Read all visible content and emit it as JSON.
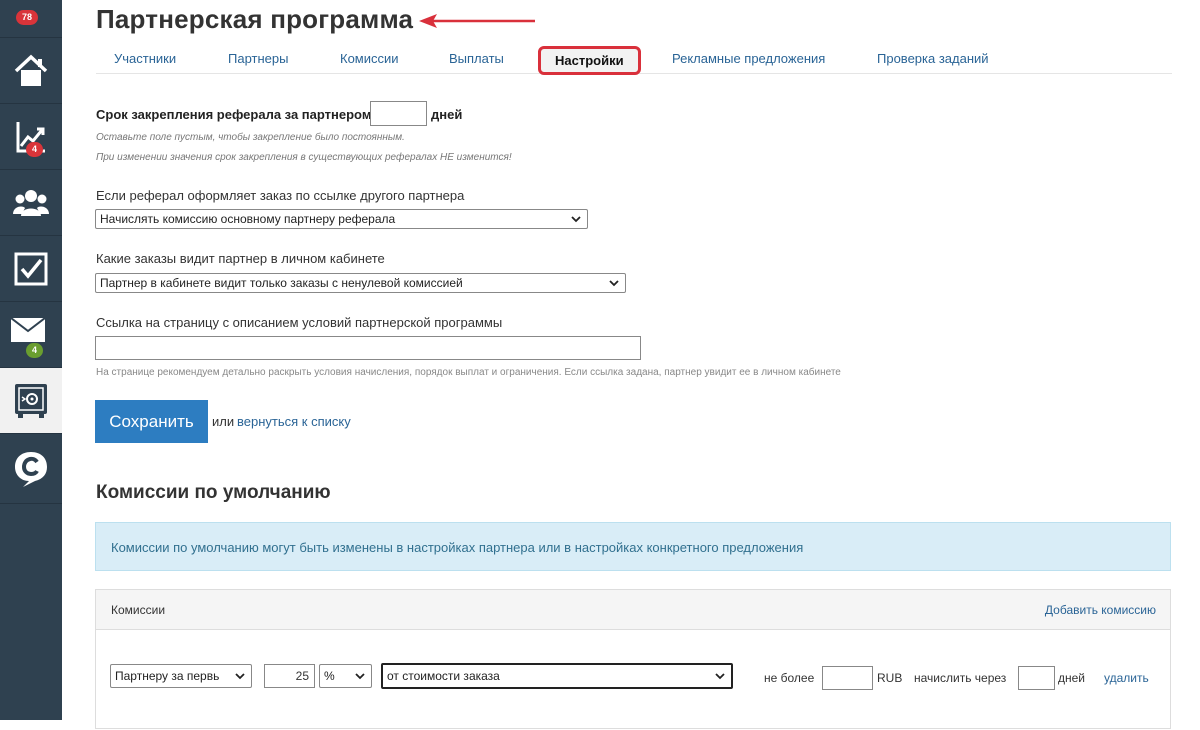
{
  "sidebar": {
    "notifications_badge": "78",
    "items": [
      {
        "icon": "home-icon"
      },
      {
        "icon": "chart-icon",
        "badge": "4"
      },
      {
        "icon": "users-icon"
      },
      {
        "icon": "tasks-icon"
      },
      {
        "icon": "mail-icon",
        "badge": "4"
      },
      {
        "icon": "safe-icon",
        "active": true
      },
      {
        "icon": "chat-icon"
      }
    ]
  },
  "header": {
    "title": "Партнерская программа"
  },
  "tabs": [
    {
      "label": "Участники"
    },
    {
      "label": "Партнеры"
    },
    {
      "label": "Комиссии"
    },
    {
      "label": "Выплаты"
    },
    {
      "label": "Настройки",
      "active": true
    },
    {
      "label": "Рекламные предложения"
    },
    {
      "label": "Проверка заданий"
    }
  ],
  "settings": {
    "referral_term_label": "Срок закрепления реферала за партнером",
    "referral_term_value": "",
    "referral_term_unit": "дней",
    "referral_hint_1": "Оставьте поле пустым, чтобы закрепление было постоянным.",
    "referral_hint_2": "При изменении значения срок закрепления в существующих рефералах НЕ изменится!",
    "other_link_label": "Если реферал оформляет заказ по ссылке другого партнера",
    "other_link_value": "Начислять комиссию основному партнеру реферала",
    "orders_visible_label": "Какие заказы видит партнер в личном кабинете",
    "orders_visible_value": "Партнер в кабинете видит только заказы с ненулевой комиссией",
    "terms_link_label": "Ссылка на страницу с описанием условий партнерской программы",
    "terms_link_value": "",
    "terms_link_hint": "На странице рекомендуем детально раскрыть условия начисления, порядок выплат и ограничения. Если ссылка задана, партнер увидит ее в личном кабинете",
    "save_label": "Сохранить",
    "or_text": "или",
    "back_link": "вернуться к списку"
  },
  "default_commissions": {
    "title": "Комиссии по умолчанию",
    "info": "Комиссии по умолчанию могут быть изменены в настройках партнера или в настройках конкретного предложения",
    "panel_title": "Комиссии",
    "add_link": "Добавить комиссию",
    "row": {
      "recipient": "Партнеру за первь",
      "amount": "25",
      "unit": "%",
      "base": "от стоимости заказа",
      "max_label": "не более",
      "max_value": "",
      "currency": "RUB",
      "delay_label": "начислить через",
      "delay_value": "",
      "delay_unit": "дней",
      "delete_label": "удалить"
    }
  }
}
